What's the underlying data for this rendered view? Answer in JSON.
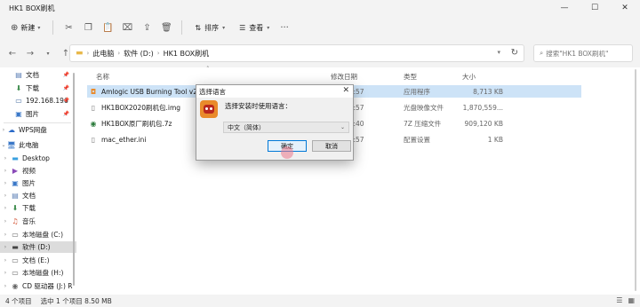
{
  "window": {
    "title": "HK1 BOX刷机",
    "controls": {
      "minimize": "—",
      "maximize": "☐",
      "close": "✕"
    }
  },
  "toolbar": {
    "new_label": "新建",
    "sort_label": "排序",
    "view_label": "查看",
    "more": "···"
  },
  "address": {
    "crumbs": [
      "此电脑",
      "软件 (D:)",
      "HK1 BOX刷机"
    ],
    "search_placeholder": "搜索\"HK1 BOX刷机\""
  },
  "sidebar": {
    "quick": [
      {
        "label": "文档",
        "icon": "document-icon",
        "color": "#5b7fb5"
      },
      {
        "label": "下载",
        "icon": "download-icon",
        "color": "#3a8a4a"
      },
      {
        "label": "192.168.196",
        "icon": "network-folder-icon",
        "color": "#4a6fa0"
      },
      {
        "label": "图片",
        "icon": "picture-icon",
        "color": "#3a78c8"
      }
    ],
    "wps": "WPS网盘",
    "this_pc": "此电脑",
    "pc_items": [
      {
        "label": "Desktop",
        "icon": "desktop-icon",
        "color": "#3aa0e0"
      },
      {
        "label": "视频",
        "icon": "video-icon",
        "color": "#8a4ab8"
      },
      {
        "label": "图片",
        "icon": "picture-icon",
        "color": "#3a78c8"
      },
      {
        "label": "文档",
        "icon": "document-icon",
        "color": "#5b7fb5"
      },
      {
        "label": "下载",
        "icon": "download-icon",
        "color": "#3a8a4a"
      },
      {
        "label": "音乐",
        "icon": "music-icon",
        "color": "#d04a2a"
      },
      {
        "label": "本地磁盘 (C:)",
        "icon": "drive-icon",
        "color": "#666666"
      },
      {
        "label": "软件 (D:)",
        "icon": "drive-icon",
        "color": "#444444"
      },
      {
        "label": "文档 (E:)",
        "icon": "drive-icon",
        "color": "#666666"
      },
      {
        "label": "本地磁盘 (H:)",
        "icon": "drive-icon",
        "color": "#666666"
      },
      {
        "label": "CD 驱动器 (J:) R",
        "icon": "cd-drive-icon",
        "color": "#666666"
      }
    ]
  },
  "columns": {
    "name": "名称",
    "modified": "修改日期",
    "type": "类型",
    "size": "大小"
  },
  "files": [
    {
      "name": "Amlogic USB Burning Tool v2.2.4",
      "modified": "18 10:57",
      "type": "应用程序",
      "size": "8,713 KB",
      "icon": "app-icon",
      "color": "#e98a2b"
    },
    {
      "name": "HK1BOX2020刷机包.img",
      "modified": "18 10:57",
      "type": "光盘映像文件",
      "size": "1,870,559...",
      "icon": "disk-image-icon",
      "color": "#777777"
    },
    {
      "name": "HK1BOX原厂刷机包.7z",
      "modified": "16 23:40",
      "type": "7Z 压缩文件",
      "size": "909,120 KB",
      "icon": "archive-icon",
      "color": "#2a7a3a"
    },
    {
      "name": "mac_ether.ini",
      "modified": "18 10:57",
      "type": "配置设置",
      "size": "1 KB",
      "icon": "settings-file-icon",
      "color": "#777777"
    }
  ],
  "status": {
    "count": "4 个项目",
    "selected": "选中 1 个项目  8.50 MB"
  },
  "dialog": {
    "title": "选择语言",
    "prompt": "选择安装时使用语言：",
    "language": "中文（简体）",
    "ok": "确定",
    "cancel": "取消"
  },
  "colors": {
    "accent": "#0078d7",
    "selected_row": "#cde3f7",
    "dialog_bg": "#f0f0f0"
  }
}
